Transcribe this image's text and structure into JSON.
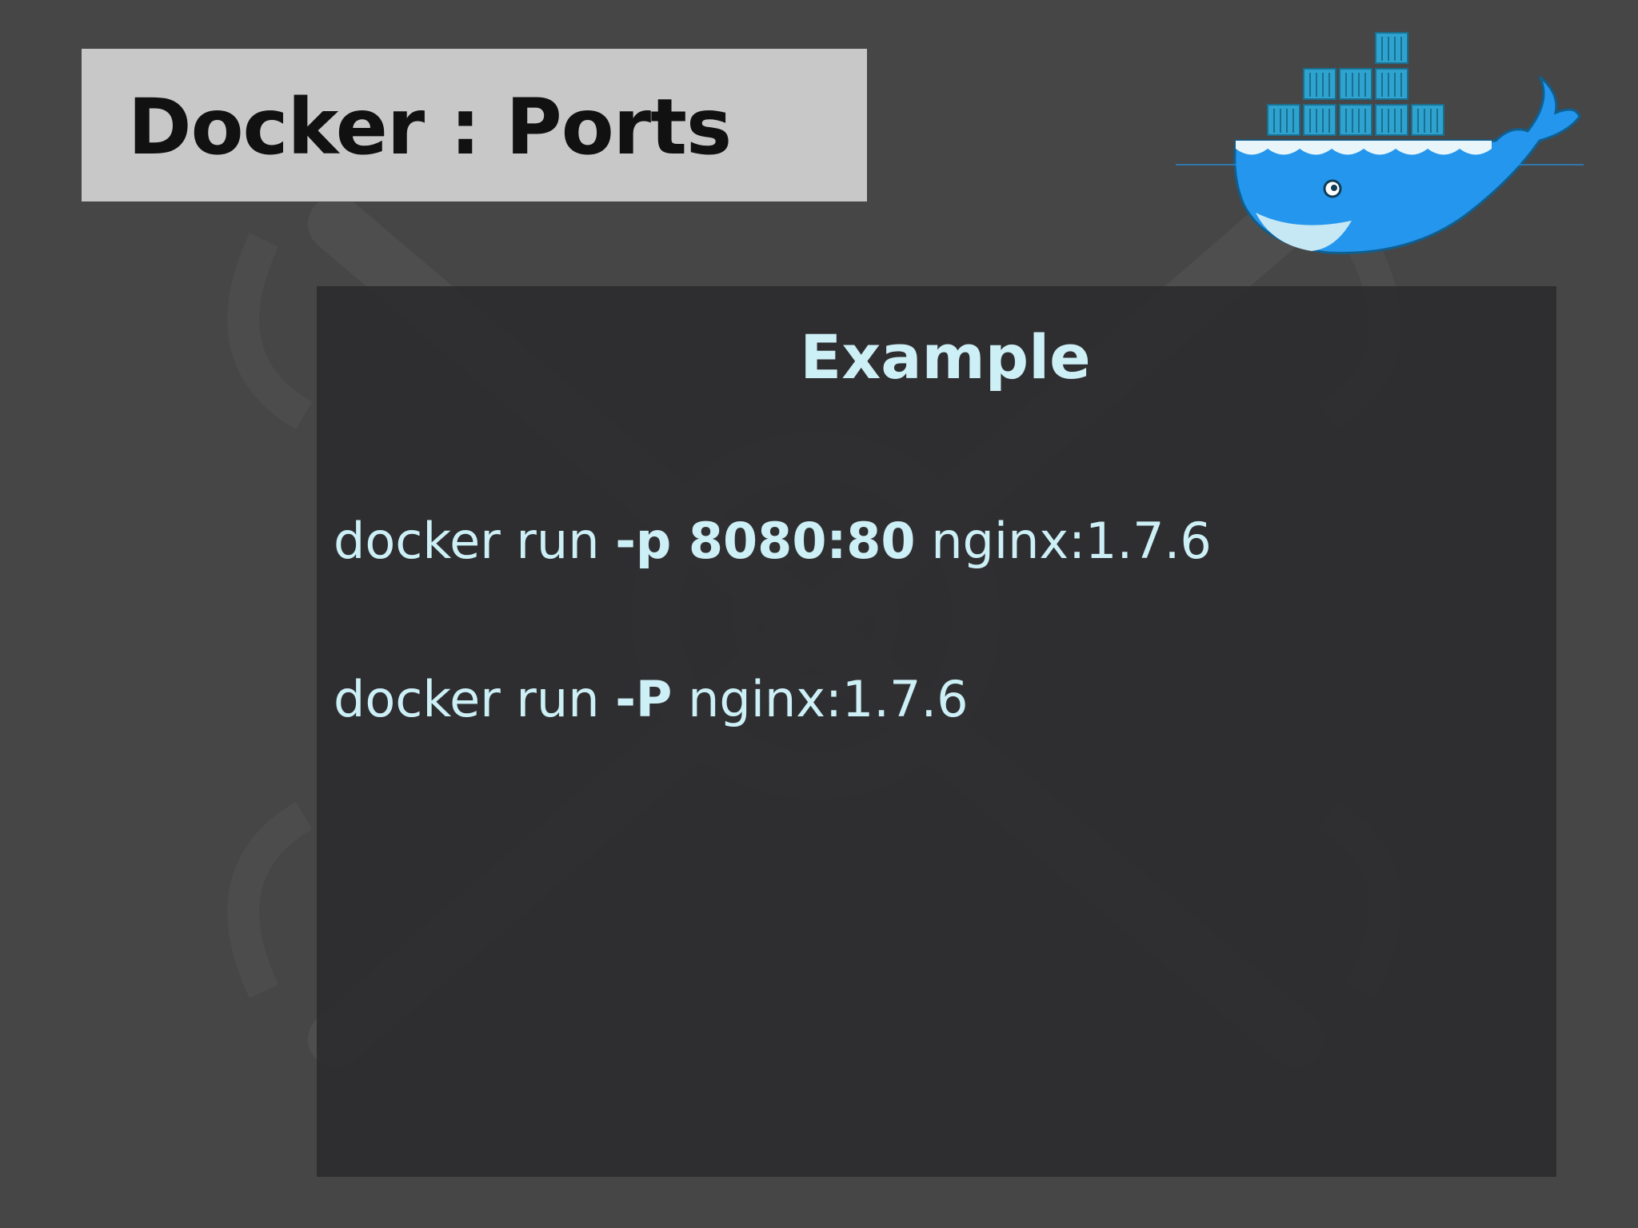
{
  "slide": {
    "title": "Docker : Ports",
    "logo_icon": "docker-whale-icon",
    "logo_colors": {
      "whale_blue": "#2496ED",
      "container_blue": "#2FA3CF",
      "belly_light": "#C6E8F5"
    }
  },
  "content": {
    "heading": "Example",
    "commands": [
      {
        "prefix": "docker run ",
        "flag": "-p 8080:80",
        "suffix": " nginx:1.7.6"
      },
      {
        "prefix": "docker run ",
        "flag": "-P",
        "suffix": " nginx:1.7.6"
      }
    ]
  },
  "colors": {
    "background": "#464647",
    "title_box": "#c8c8c8",
    "panel": "#2b2b2d",
    "text_accent": "#cdeff6"
  }
}
